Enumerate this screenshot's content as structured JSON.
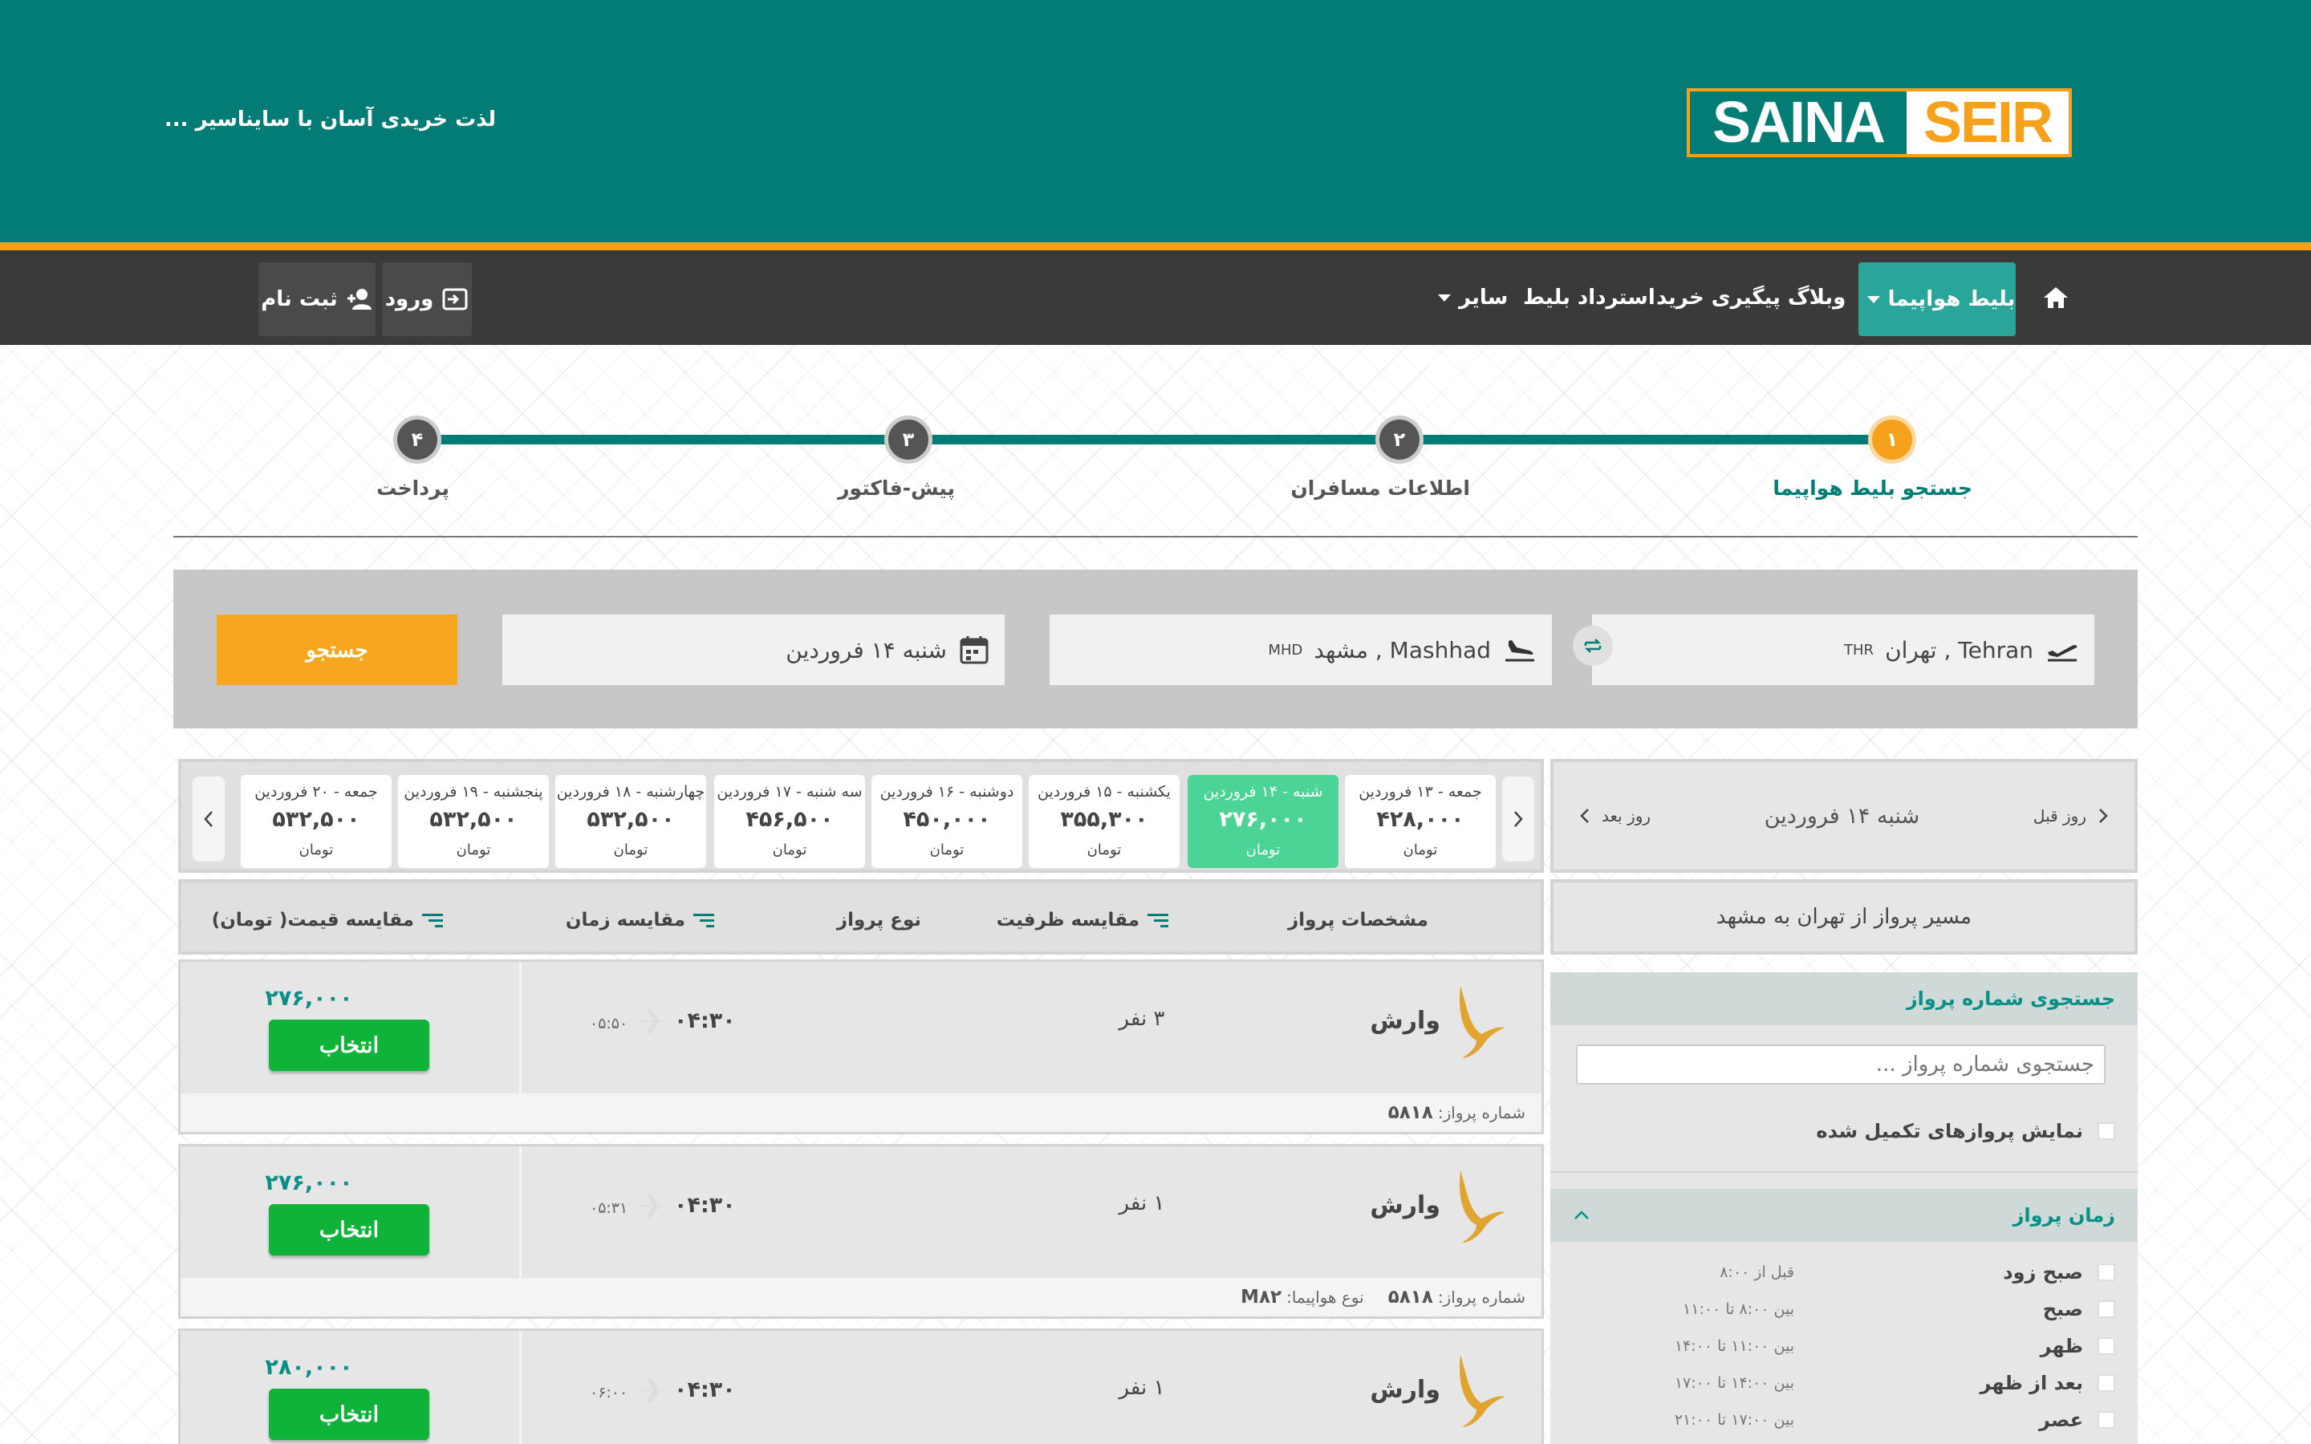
{
  "header": {
    "tagline": "لذت خریدی آسان با ساینا‌سیر ...",
    "logo_part1": "SAINA",
    "logo_part2": "SEIR"
  },
  "nav": {
    "active_item": "بلیط هواپیما",
    "items": [
      "وبلاگ",
      "پیگیری خرید",
      "استرداد بلیط",
      "سایر"
    ],
    "login": "ورود",
    "register": "ثبت نام"
  },
  "stepper": {
    "steps": [
      {
        "num": "۱",
        "label": "جستجو بلیط هواپیما"
      },
      {
        "num": "۲",
        "label": "اطلاعات مسافران"
      },
      {
        "num": "۳",
        "label": "پیش-فاکتور"
      },
      {
        "num": "۴",
        "label": "پرداخت"
      }
    ]
  },
  "search": {
    "origin": "Tehran , تهران",
    "origin_code": "THR",
    "destination": "Mashhad , مشهد",
    "destination_code": "MHD",
    "date": "شنبه ۱۴ فروردین",
    "button": "جستجو"
  },
  "date_nav": {
    "prev": "روز قبل",
    "current": "شنبه ۱۴ فروردین",
    "next": "روز بعد"
  },
  "route_title": "مسیر پرواز از تهران به مشهد",
  "days": [
    {
      "date": "جمعه - ۱۳ فروردین",
      "price": "۴۲۸,۰۰۰",
      "currency": "تومان"
    },
    {
      "date": "شنبه - ۱۴ فروردین",
      "price": "۲۷۶,۰۰۰",
      "currency": "تومان"
    },
    {
      "date": "یکشنبه - ۱۵ فروردین",
      "price": "۳۵۵,۳۰۰",
      "currency": "تومان"
    },
    {
      "date": "دوشنبه - ۱۶ فروردین",
      "price": "۴۵۰,۰۰۰",
      "currency": "تومان"
    },
    {
      "date": "سه شنبه - ۱۷ فروردین",
      "price": "۴۵۶,۵۰۰",
      "currency": "تومان"
    },
    {
      "date": "چهارشنبه - ۱۸ فروردین",
      "price": "۵۳۲,۵۰۰",
      "currency": "تومان"
    },
    {
      "date": "پنجشنبه - ۱۹ فروردین",
      "price": "۵۳۲,۵۰۰",
      "currency": "تومان"
    },
    {
      "date": "جمعه - ۲۰ فروردین",
      "price": "۵۳۲,۵۰۰",
      "currency": "تومان"
    }
  ],
  "columns": {
    "flight_info": "مشخصات پرواز",
    "capacity": "مقایسه ظرفیت",
    "flight_type": "نوع پرواز",
    "time": "مقایسه زمان",
    "price": "مقایسه قیمت( تومان)"
  },
  "flights": [
    {
      "airline": "وارش",
      "capacity": "۳ نفر",
      "depart": "۰۴:۳۰",
      "arrive": "۰۵:۵۰",
      "price": "۲۷۶,۰۰۰",
      "select": "انتخاب",
      "flight_no_label": "شماره پرواز:",
      "flight_no": "۵۸۱۸",
      "aircraft_label": "",
      "aircraft": ""
    },
    {
      "airline": "وارش",
      "capacity": "۱ نفر",
      "depart": "۰۴:۳۰",
      "arrive": "۰۵:۳۱",
      "price": "۲۷۶,۰۰۰",
      "select": "انتخاب",
      "flight_no_label": "شماره پرواز:",
      "flight_no": "۵۸۱۸",
      "aircraft_label": "نوع هواپیما:",
      "aircraft": "M۸۲"
    },
    {
      "airline": "وارش",
      "capacity": "۱ نفر",
      "depart": "۰۴:۳۰",
      "arrive": "۰۶:۰۰",
      "price": "۲۸۰,۰۰۰",
      "select": "انتخاب",
      "flight_no_label": "",
      "flight_no": "",
      "aircraft_label": "",
      "aircraft": ""
    }
  ],
  "filters": {
    "flight_search_title": "جستجوی شماره پرواز",
    "flight_search_placeholder": "جستجوی شماره پرواز ...",
    "show_full": "نمایش پروازهای تکمیل شده",
    "time_title": "زمان پرواز",
    "time_options": [
      {
        "label": "صبح زود",
        "range": "قبل از ۸:۰۰"
      },
      {
        "label": "صبح",
        "range": "بین ۸:۰۰ تا ۱۱:۰۰"
      },
      {
        "label": "ظهر",
        "range": "بین ۱۱:۰۰ تا ۱۴:۰۰"
      },
      {
        "label": "بعد از ظهر",
        "range": "بین ۱۴:۰۰ تا ۱۷:۰۰"
      },
      {
        "label": "عصر",
        "range": "بین ۱۷:۰۰ تا ۲۱:۰۰"
      }
    ]
  },
  "colors": {
    "brand_teal": "#027c75",
    "accent_orange": "#f5a11c",
    "active_day": "#4cd497",
    "select_green": "#0fb33a"
  }
}
